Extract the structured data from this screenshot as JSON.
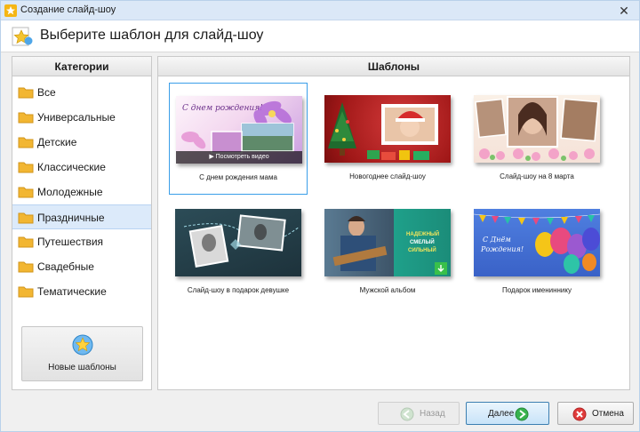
{
  "window": {
    "title": "Создание слайд-шоу",
    "close_glyph": "✕"
  },
  "header": {
    "title": "Выберите шаблон для слайд-шоу"
  },
  "categories": {
    "heading": "Категории",
    "items": [
      {
        "label": "Все"
      },
      {
        "label": "Универсальные"
      },
      {
        "label": "Детские"
      },
      {
        "label": "Классические"
      },
      {
        "label": "Молодежные"
      },
      {
        "label": "Праздничные",
        "selected": true
      },
      {
        "label": "Путешествия"
      },
      {
        "label": "Свадебные"
      },
      {
        "label": "Тематические"
      }
    ],
    "new_templates_label": "Новые шаблоны"
  },
  "templates": {
    "heading": "Шаблоны",
    "items": [
      {
        "caption": "С днем рождения мама",
        "thumb_text": "С днем рождения!",
        "play_label": "Посмотреть видео",
        "selected": true
      },
      {
        "caption": "Новогоднее слайд-шоу"
      },
      {
        "caption": "Слайд-шоу на 8 марта"
      },
      {
        "caption": "Слайд-шоу в подарок девушке"
      },
      {
        "caption": "Мужской альбом",
        "thumb_text_lines": [
          "НАДЕЖНЫЙ",
          "СМЕЛЫЙ",
          "СИЛЬНЫЙ"
        ]
      },
      {
        "caption": "Подарок имениннику",
        "thumb_text_lines": [
          "С Днём",
          "Рождения!"
        ]
      }
    ]
  },
  "footer": {
    "back_label": "Назад",
    "next_label": "Далее",
    "cancel_label": "Отмена"
  },
  "colors": {
    "accent": "#3a9ee8",
    "selection": "#dceafa",
    "folder": "#f2b632"
  }
}
